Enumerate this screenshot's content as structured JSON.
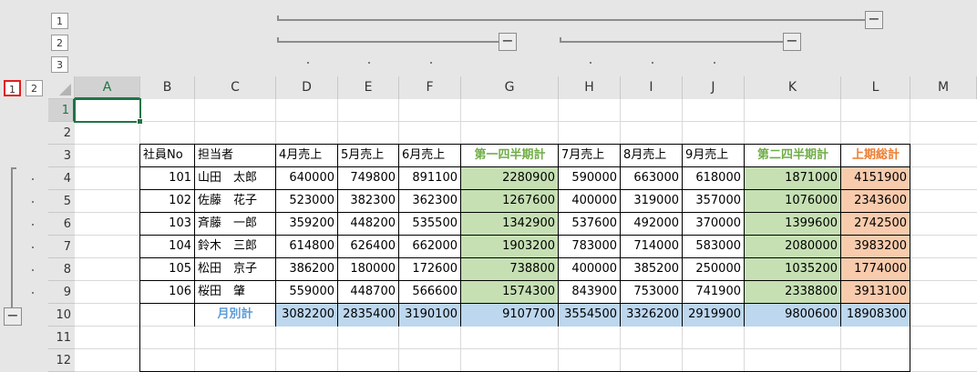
{
  "outline": {
    "col_levels": [
      "1",
      "2",
      "3"
    ],
    "row_levels": [
      "1",
      "2"
    ],
    "minus_symbol": "−"
  },
  "columns": [
    "A",
    "B",
    "C",
    "D",
    "E",
    "F",
    "G",
    "H",
    "I",
    "J",
    "K",
    "L",
    "M"
  ],
  "rows": [
    "1",
    "2",
    "3",
    "4",
    "5",
    "6",
    "7",
    "8",
    "9",
    "10",
    "11",
    "12"
  ],
  "table": {
    "headers": [
      "社員No",
      "担当者",
      "4月売上",
      "5月売上",
      "6月売上",
      "第一四半期計",
      "7月売上",
      "8月売上",
      "9月売上",
      "第二四半期計",
      "上期総計"
    ],
    "data": [
      [
        "101",
        "山田　太郎",
        "640000",
        "749800",
        "891100",
        "2280900",
        "590000",
        "663000",
        "618000",
        "1871000",
        "4151900"
      ],
      [
        "102",
        "佐藤　花子",
        "523000",
        "382300",
        "362300",
        "1267600",
        "400000",
        "319000",
        "357000",
        "1076000",
        "2343600"
      ],
      [
        "103",
        "斉藤　一郎",
        "359200",
        "448200",
        "535500",
        "1342900",
        "537600",
        "492000",
        "370000",
        "1399600",
        "2742500"
      ],
      [
        "104",
        "鈴木　三郎",
        "614800",
        "626400",
        "662000",
        "1903200",
        "783000",
        "714000",
        "583000",
        "2080000",
        "3983200"
      ],
      [
        "105",
        "松田　京子",
        "386200",
        "180000",
        "172600",
        "738800",
        "400000",
        "385200",
        "250000",
        "1035200",
        "1774000"
      ],
      [
        "106",
        "桜田　肇",
        "559000",
        "448700",
        "566600",
        "1574300",
        "843900",
        "753000",
        "741900",
        "2338800",
        "3913100"
      ]
    ],
    "total": [
      "",
      "月別計",
      "3082200",
      "2835400",
      "3190100",
      "9107700",
      "3554500",
      "3326200",
      "2919900",
      "9800600",
      "18908300"
    ]
  },
  "colors": {
    "quarter_fill": "#c6e0b4",
    "quarter_header": "#70ad47",
    "grand_fill": "#f8cbad",
    "grand_header": "#ed7d31",
    "total_fill": "#bdd7ee",
    "total_label": "#5b9bd5",
    "active_cell": "#217346",
    "highlight_box": "#e02020"
  }
}
